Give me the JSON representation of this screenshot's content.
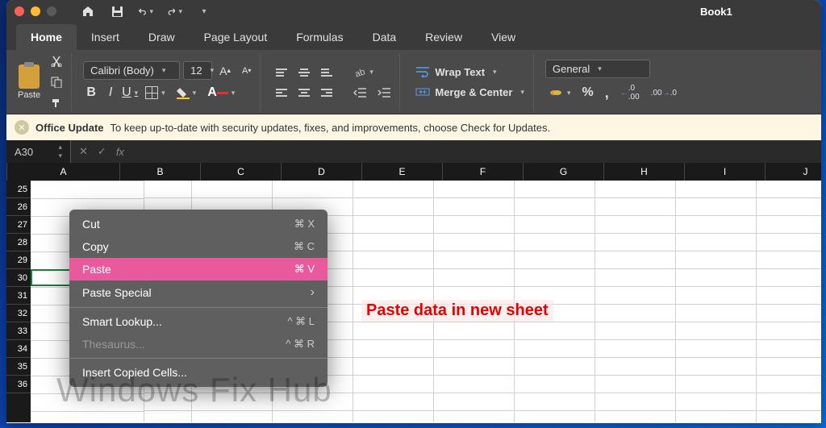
{
  "window": {
    "title": "Book1"
  },
  "tabs": [
    "Home",
    "Insert",
    "Draw",
    "Page Layout",
    "Formulas",
    "Data",
    "Review",
    "View"
  ],
  "active_tab": "Home",
  "ribbon": {
    "paste_label": "Paste",
    "font_name": "Calibri (Body)",
    "font_size": "12",
    "bold": "B",
    "italic": "I",
    "underline": "U",
    "wrap_text": "Wrap Text",
    "merge_center": "Merge & Center",
    "number_format": "General",
    "percent": "%",
    "comma": ",",
    "inc_dec": ".0",
    "dec_inc": ".00"
  },
  "update_bar": {
    "title": "Office Update",
    "message": "To keep up-to-date with security updates, fixes, and improvements, choose Check for Updates."
  },
  "formula_bar": {
    "cell_ref": "A30",
    "fx": "fx"
  },
  "columns": [
    "A",
    "B",
    "C",
    "D",
    "E",
    "F",
    "G",
    "H",
    "I",
    "J"
  ],
  "rows": [
    "25",
    "26",
    "27",
    "28",
    "29",
    "30",
    "31",
    "32",
    "33",
    "34",
    "35",
    "36"
  ],
  "context_menu": {
    "cut": "Cut",
    "cut_sc": "⌘ X",
    "copy": "Copy",
    "copy_sc": "⌘ C",
    "paste": "Paste",
    "paste_sc": "⌘ V",
    "paste_special": "Paste Special",
    "smart_lookup": "Smart Lookup...",
    "smart_sc": "^ ⌘ L",
    "thesaurus": "Thesaurus...",
    "thes_sc": "^ ⌘ R",
    "insert_copied": "Insert Copied Cells..."
  },
  "annotation": "Paste data in new sheet",
  "watermark": "Windows Fix Hub"
}
